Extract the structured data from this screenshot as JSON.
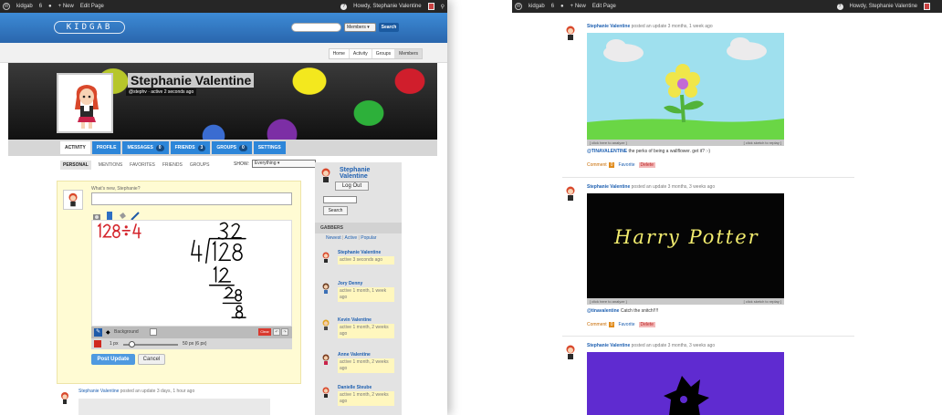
{
  "left": {
    "adminbar": {
      "site": "kidgab",
      "updates": "6",
      "new_label": "+ New",
      "edit_label": "Edit Page",
      "howdy": "Howdy, Stephanie Valentine"
    },
    "header": {
      "logo": "KIDGAB",
      "search_scope": "Members",
      "search_button": "Search"
    },
    "subnav": [
      "Home",
      "Activity",
      "Groups",
      "Members"
    ],
    "profile": {
      "name": "Stephanie Valentine",
      "handle": "@stephv",
      "active": "active 2 seconds ago"
    },
    "tabs": [
      {
        "label": "ACTIVITY",
        "badge": ""
      },
      {
        "label": "PROFILE",
        "badge": ""
      },
      {
        "label": "MESSAGES",
        "badge": "0"
      },
      {
        "label": "FRIENDS",
        "badge": "3"
      },
      {
        "label": "GROUPS",
        "badge": "0"
      },
      {
        "label": "SETTINGS",
        "badge": ""
      }
    ],
    "filters": [
      "PERSONAL",
      "MENTIONS",
      "FAVORITES",
      "FRIENDS",
      "GROUPS"
    ],
    "show": {
      "label": "SHOW:",
      "value": "Everything"
    },
    "composer": {
      "prompt": "What's new, Stephanie?",
      "bg_label": "Background",
      "min_size": "1 px",
      "max_size": "50 px (6 px)",
      "clear": "Clear",
      "post_button": "Post Update",
      "cancel_button": "Cancel"
    },
    "activity": {
      "author": "Stephanie Valentine",
      "text": "posted an update 3 days, 1 hour ago"
    },
    "sidebar": {
      "name": "Stephanie Valentine",
      "logout": "Log Out",
      "search_button": "Search",
      "heading": "GABBERS",
      "links": [
        "Newest",
        "Active",
        "Popular"
      ],
      "members": [
        {
          "name": "Stephanie Valentine",
          "active": "active 3 seconds ago"
        },
        {
          "name": "Jory Denny",
          "active": "active 1 month, 1 week ago"
        },
        {
          "name": "Kevin Valentine",
          "active": "active 1 month, 2 weeks ago"
        },
        {
          "name": "Anne Valentine",
          "active": "active 1 month, 2 weeks ago"
        },
        {
          "name": "Danielle Steube",
          "active": "active 1 month, 2 weeks ago"
        }
      ]
    }
  },
  "right": {
    "adminbar": {
      "site": "kidgab",
      "updates": "6",
      "new_label": "+ New",
      "edit_label": "Edit Page",
      "howdy": "Howdy, Stephanie Valentine"
    },
    "posts": [
      {
        "author": "Stephanie Valentine",
        "meta": "posted an update 3 months, 1 week ago",
        "bar_left": "[ click here to analyze ]",
        "bar_right": "[ click sketch to replay ]",
        "caption_user": "@TINAVALENTINE",
        "caption_text": "the perks of being a wallflower. get it? :-)",
        "comment_label": "Comment",
        "comment_count": "0",
        "favorite": "Favorite",
        "delete": "Delete"
      },
      {
        "author": "Stephanie Valentine",
        "meta": "posted an update 3 months, 3 weeks ago",
        "image_text": "Harry Potter",
        "bar_left": "[ click here to analyze ]",
        "bar_right": "[ click sketch to replay ]",
        "caption_user": "@tinavalentine",
        "caption_text": "Catch the snitch!!!!",
        "comment_label": "Comment",
        "comment_count": "0",
        "favorite": "Favorite",
        "delete": "Delete"
      },
      {
        "author": "Stephanie Valentine",
        "meta": "posted an update 3 months, 3 weeks ago"
      }
    ]
  },
  "colors": {
    "brand_blue": "#2d86d9",
    "admin_bar": "#262626",
    "composer_bg": "#fffbd3",
    "delete_red": "#d93a2f"
  }
}
